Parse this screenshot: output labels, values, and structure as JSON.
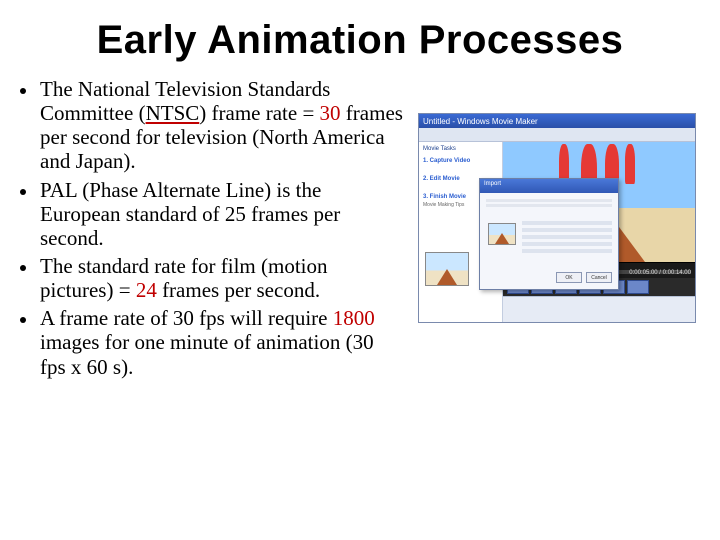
{
  "title": "Early Animation Processes",
  "bullets": [
    {
      "pre": "The National Television Standards Committee (",
      "u": "NTSC",
      "post1": ") frame rate = ",
      "hl": "30",
      "post2": " frames per second for television (North America and Japan)."
    },
    {
      "pre": "PAL (Phase Alternate Line) is the European standard of 25 frames per second.",
      "u": "",
      "post1": "",
      "hl": "",
      "post2": ""
    },
    {
      "pre": "The standard rate for film (motion pictures) = ",
      "u": "",
      "post1": "",
      "hl": "24",
      "post2": " frames per second."
    },
    {
      "pre": "A frame rate of 30 fps will require ",
      "u": "",
      "post1": "",
      "hl": "1800",
      "post2": " images for one minute of animation (30 fps x 60 s)."
    }
  ],
  "figure": {
    "windowTitle": "Untitled - Windows Movie Maker",
    "panel": {
      "heading": "Movie Tasks",
      "step1": "1. Capture Video",
      "step2": "2. Edit Movie",
      "step3": "3. Finish Movie",
      "tips": "Movie Making Tips"
    },
    "dialog": {
      "title": "Import",
      "ok": "OK",
      "cancel": "Cancel"
    },
    "timecode": "0:00:05.00 / 0:00:14.00"
  }
}
